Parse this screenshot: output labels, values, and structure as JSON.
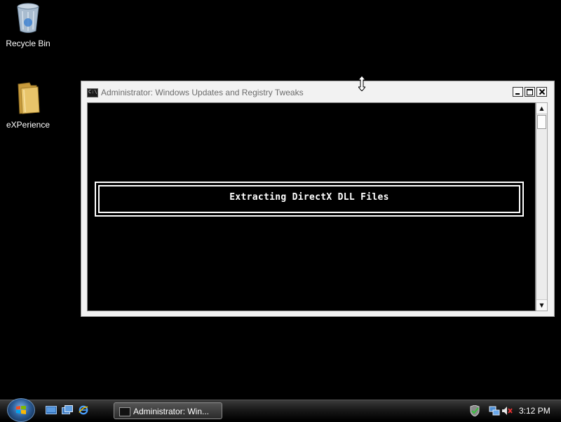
{
  "desktop": {
    "icons": [
      {
        "label": "Recycle Bin",
        "icon": "recycle-bin-icon"
      },
      {
        "label": "eXPerience",
        "icon": "folder-icon"
      }
    ]
  },
  "window": {
    "title": "Administrator:  Windows Updates and Registry Tweaks",
    "console_message": "Extracting DirectX DLL Files"
  },
  "taskbar": {
    "start_icon": "windows-start-orb",
    "quick_launch": [
      "show-desktop-icon",
      "switch-windows-icon",
      "internet-explorer-icon"
    ],
    "tasks": [
      {
        "label": "Administrator:  Win...",
        "icon": "command-prompt-icon"
      }
    ],
    "tray_icons": [
      "security-shield-icon",
      "network-icon",
      "volume-muted-icon"
    ],
    "clock": "3:12 PM"
  },
  "colors": {
    "desktop_bg": "#000000",
    "console_bg": "#000000",
    "console_text": "#ffffff"
  }
}
